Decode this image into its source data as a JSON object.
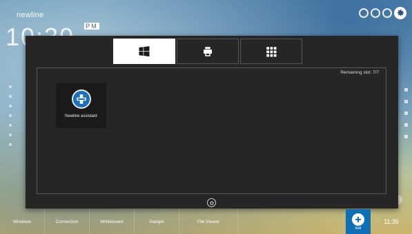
{
  "header": {
    "brand": "newline",
    "clock": "10:30",
    "clock_badge": "PM"
  },
  "panel": {
    "tabs": [
      {
        "icon": "windows-icon",
        "active": true
      },
      {
        "icon": "printer-icon",
        "active": false
      },
      {
        "icon": "apps-grid-icon",
        "active": false
      }
    ],
    "remaining_slot": "Remaining slot: 7/7",
    "apps": [
      {
        "label": "Newline assistant",
        "icon": "newline-assistant-icon"
      }
    ],
    "home_icon": "home-icon"
  },
  "taskbar": {
    "items": [
      {
        "label": "Windows"
      },
      {
        "label": "Connection"
      },
      {
        "label": "Whiteboard"
      },
      {
        "label": "Gadget"
      },
      {
        "label": "File Viewer"
      }
    ],
    "add_label": "Add",
    "time": "11:35"
  },
  "colors": {
    "panel": "#262626",
    "accent_blue": "#0f6fb5",
    "app_icon_blue": "#1d6fb8"
  }
}
